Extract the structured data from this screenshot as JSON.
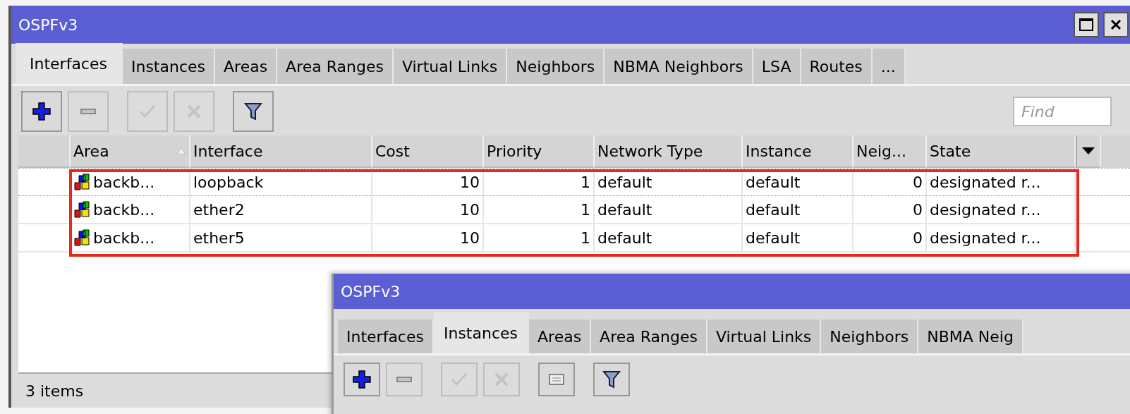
{
  "windows": [
    {
      "title": "OSPFv3",
      "tabs": [
        {
          "label": "Interfaces",
          "selected": true
        },
        {
          "label": "Instances",
          "selected": false
        },
        {
          "label": "Areas",
          "selected": false
        },
        {
          "label": "Area Ranges",
          "selected": false
        },
        {
          "label": "Virtual Links",
          "selected": false
        },
        {
          "label": "Neighbors",
          "selected": false
        },
        {
          "label": "NBMA Neighbors",
          "selected": false
        },
        {
          "label": "LSA",
          "selected": false
        },
        {
          "label": "Routes",
          "selected": false
        },
        {
          "label": "...",
          "selected": false
        }
      ],
      "toolbar": [
        {
          "kind": "add",
          "disabled": false
        },
        {
          "kind": "remove",
          "disabled": true
        },
        {
          "kind": "enable",
          "disabled": true
        },
        {
          "kind": "disable",
          "disabled": true
        },
        {
          "kind": "filter",
          "disabled": false
        }
      ],
      "search": {
        "placeholder": "Find"
      },
      "table": {
        "columns": [
          {
            "label": "Area",
            "sorted": true
          },
          {
            "label": "Interface",
            "sorted": false
          },
          {
            "label": "Cost",
            "sorted": false
          },
          {
            "label": "Priority",
            "sorted": false
          },
          {
            "label": "Network Type",
            "sorted": false
          },
          {
            "label": "Instance",
            "sorted": false
          },
          {
            "label": "Neig...",
            "sorted": false
          },
          {
            "label": "State",
            "sorted": false
          }
        ],
        "rows": [
          {
            "cells": [
              "backb...",
              "loopback",
              "10",
              "1",
              "default",
              "default",
              "0",
              "designated r..."
            ]
          },
          {
            "cells": [
              "backb...",
              "ether2",
              "10",
              "1",
              "default",
              "default",
              "0",
              "designated r..."
            ]
          },
          {
            "cells": [
              "backb...",
              "ether5",
              "10",
              "1",
              "default",
              "default",
              "0",
              "designated r..."
            ]
          }
        ]
      },
      "status_bar": "3 items"
    },
    {
      "title": "OSPFv3",
      "tabs": [
        {
          "label": "Interfaces",
          "selected": false
        },
        {
          "label": "Instances",
          "selected": true
        },
        {
          "label": "Areas",
          "selected": false
        },
        {
          "label": "Area Ranges",
          "selected": false
        },
        {
          "label": "Virtual Links",
          "selected": false
        },
        {
          "label": "Neighbors",
          "selected": false
        },
        {
          "label": "NBMA Neig",
          "selected": false
        }
      ],
      "toolbar": [
        {
          "kind": "add",
          "disabled": false
        },
        {
          "kind": "remove",
          "disabled": true
        },
        {
          "kind": "enable",
          "disabled": true
        },
        {
          "kind": "disable",
          "disabled": true
        },
        {
          "kind": "comment",
          "disabled": false
        },
        {
          "kind": "filter",
          "disabled": false
        }
      ]
    }
  ]
}
